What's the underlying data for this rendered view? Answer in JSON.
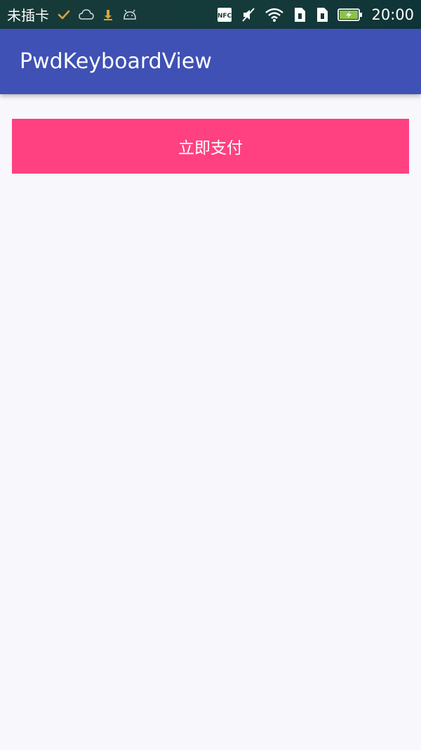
{
  "status_bar": {
    "carrier": "未插卡",
    "nfc_label": "NFC",
    "time": "20:00",
    "icons": [
      "check-icon",
      "cloud-icon",
      "download-icon",
      "android-icon",
      "nfc-icon",
      "mute-icon",
      "wifi-icon",
      "sim1-icon",
      "sim2-icon",
      "battery-charging-icon"
    ],
    "colors": {
      "check": "#d9a33b",
      "download": "#d9a33b",
      "battery": "#8bc34a"
    }
  },
  "app_bar": {
    "title": "PwdKeyboardView",
    "color": "#3f51b5"
  },
  "main": {
    "pay_button_label": "立即支付",
    "pay_button_color": "#ff4081"
  }
}
